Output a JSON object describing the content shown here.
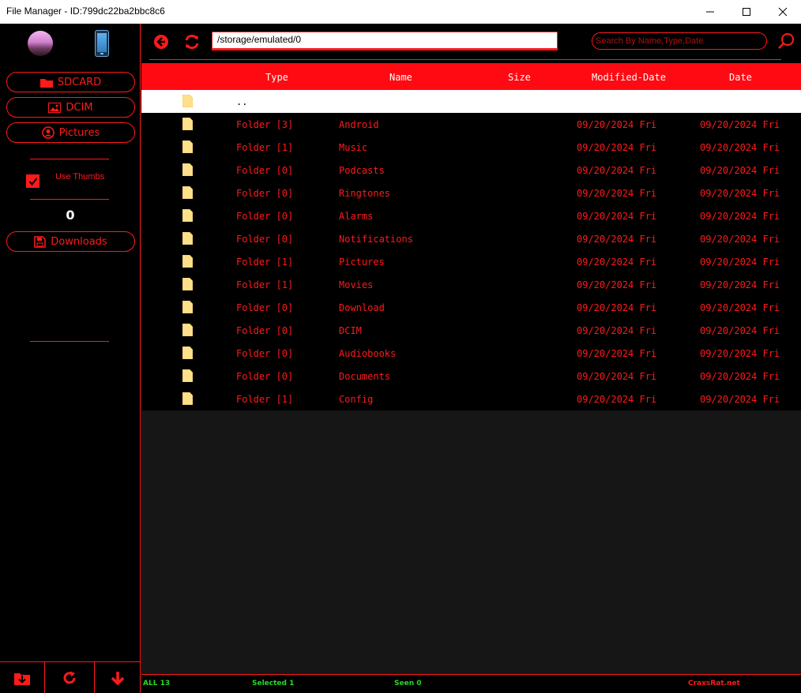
{
  "window": {
    "title": "File Manager - ID:799dc22ba2bbc8c6"
  },
  "sidebar": {
    "buttons": [
      {
        "label": "SDCARD",
        "icon": "folder-icon"
      },
      {
        "label": "DCIM",
        "icon": "image-icon"
      },
      {
        "label": "Pictures",
        "icon": "user-circle-icon"
      }
    ],
    "use_thumbs_label": "Use Thumbs",
    "use_thumbs_checked": true,
    "counter": "0",
    "downloads_label": "Downloads"
  },
  "toolbar": {
    "path": "/storage/emulated/0",
    "search_placeholder": "Search By Name,Type,Date"
  },
  "table": {
    "headers": [
      "Type",
      "Name",
      "Size",
      "Modified-Date",
      "Date"
    ],
    "parent_label": "..",
    "rows": [
      {
        "type": "Folder [3]",
        "name": "Android",
        "size": "",
        "modified": "09/20/2024 Fri",
        "date": "09/20/2024 Fri"
      },
      {
        "type": "Folder [1]",
        "name": "Music",
        "size": "",
        "modified": "09/20/2024 Fri",
        "date": "09/20/2024 Fri"
      },
      {
        "type": "Folder [0]",
        "name": "Podcasts",
        "size": "",
        "modified": "09/20/2024 Fri",
        "date": "09/20/2024 Fri"
      },
      {
        "type": "Folder [0]",
        "name": "Ringtones",
        "size": "",
        "modified": "09/20/2024 Fri",
        "date": "09/20/2024 Fri"
      },
      {
        "type": "Folder [0]",
        "name": "Alarms",
        "size": "",
        "modified": "09/20/2024 Fri",
        "date": "09/20/2024 Fri"
      },
      {
        "type": "Folder [0]",
        "name": "Notifications",
        "size": "",
        "modified": "09/20/2024 Fri",
        "date": "09/20/2024 Fri"
      },
      {
        "type": "Folder [1]",
        "name": "Pictures",
        "size": "",
        "modified": "09/20/2024 Fri",
        "date": "09/20/2024 Fri"
      },
      {
        "type": "Folder [1]",
        "name": "Movies",
        "size": "",
        "modified": "09/20/2024 Fri",
        "date": "09/20/2024 Fri"
      },
      {
        "type": "Folder [0]",
        "name": "Download",
        "size": "",
        "modified": "09/20/2024 Fri",
        "date": "09/20/2024 Fri"
      },
      {
        "type": "Folder [0]",
        "name": "DCIM",
        "size": "",
        "modified": "09/20/2024 Fri",
        "date": "09/20/2024 Fri"
      },
      {
        "type": "Folder [0]",
        "name": "Audiobooks",
        "size": "",
        "modified": "09/20/2024 Fri",
        "date": "09/20/2024 Fri"
      },
      {
        "type": "Folder [0]",
        "name": "Documents",
        "size": "",
        "modified": "09/20/2024 Fri",
        "date": "09/20/2024 Fri"
      },
      {
        "type": "Folder [1]",
        "name": "Config",
        "size": "",
        "modified": "09/20/2024 Fri",
        "date": "09/20/2024 Fri"
      }
    ]
  },
  "status": {
    "all": "ALL 13",
    "selected": "Selected 1",
    "seen": "Seen 0",
    "brand": "CraxsRat.net"
  },
  "colors": {
    "accent": "#ff1a1a",
    "header_bg": "#ff0a12",
    "status_green": "#22dd22",
    "folder_yellow": "#ffe08a"
  }
}
